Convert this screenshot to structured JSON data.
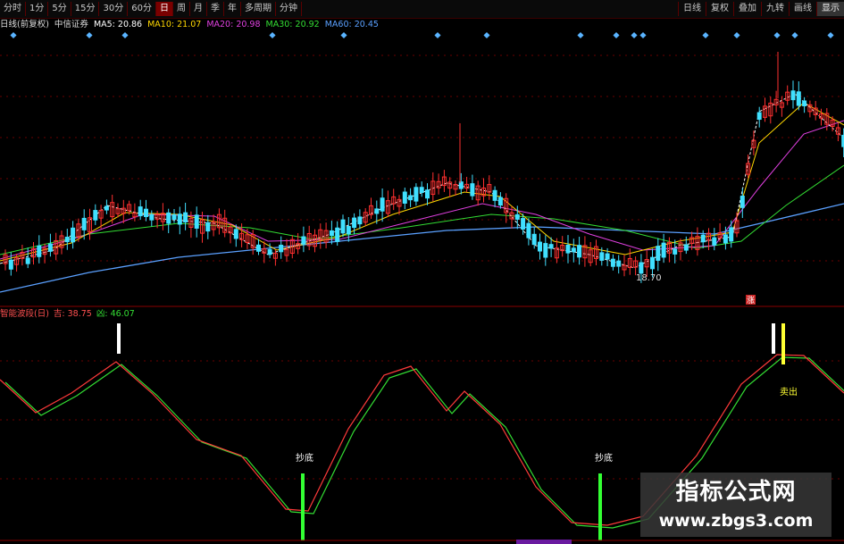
{
  "toolbar": {
    "tabs": [
      {
        "label": "分时",
        "active": false
      },
      {
        "label": "1分",
        "active": false
      },
      {
        "label": "5分",
        "active": false
      },
      {
        "label": "15分",
        "active": false
      },
      {
        "label": "30分",
        "active": false
      },
      {
        "label": "60分",
        "active": false
      },
      {
        "label": "日",
        "active": true
      },
      {
        "label": "周",
        "active": false
      },
      {
        "label": "月",
        "active": false
      },
      {
        "label": "季",
        "active": false
      },
      {
        "label": "年",
        "active": false
      },
      {
        "label": "多周期",
        "active": false
      },
      {
        "label": "分钟",
        "active": false
      }
    ],
    "right": [
      "日线",
      "复权",
      "叠加",
      "九转",
      "画线",
      "显示"
    ]
  },
  "ma_legend": {
    "label": "日线(前复权)",
    "indicator": "中信证券",
    "items": [
      {
        "text": "MA5: 20.86",
        "color": "#ffffff"
      },
      {
        "text": "MA10: 21.07",
        "color": "#ffd700"
      },
      {
        "text": "MA20: 20.98",
        "color": "#e040e0"
      },
      {
        "text": "MA30: 20.92",
        "color": "#33dd33"
      },
      {
        "text": "MA60: 20.45",
        "color": "#5aa0ff"
      }
    ]
  },
  "price_chart": {
    "low_label": "18.70",
    "marker_label": "涨"
  },
  "indicator_legend": {
    "name": "智能波段(日)",
    "items": [
      {
        "text": "吉: 38.75",
        "color": "#ff5050"
      },
      {
        "text": "凶: 46.07",
        "color": "#33dd33"
      }
    ]
  },
  "signals": {
    "buy_label": "抄底",
    "sell_label": "卖出"
  },
  "watermark": {
    "title": "指标公式网",
    "url": "www.zbgs3.com"
  },
  "colors": {
    "up": "#ff3030",
    "down": "#40e0ff",
    "grid": "#6a0000",
    "fast_line": "#ff3a3a",
    "slow_line": "#33dd33",
    "buy_bar": "#33ff33",
    "sell_bar_white": "#ffffff",
    "sell_bar_yellow": "#ffff33"
  }
}
